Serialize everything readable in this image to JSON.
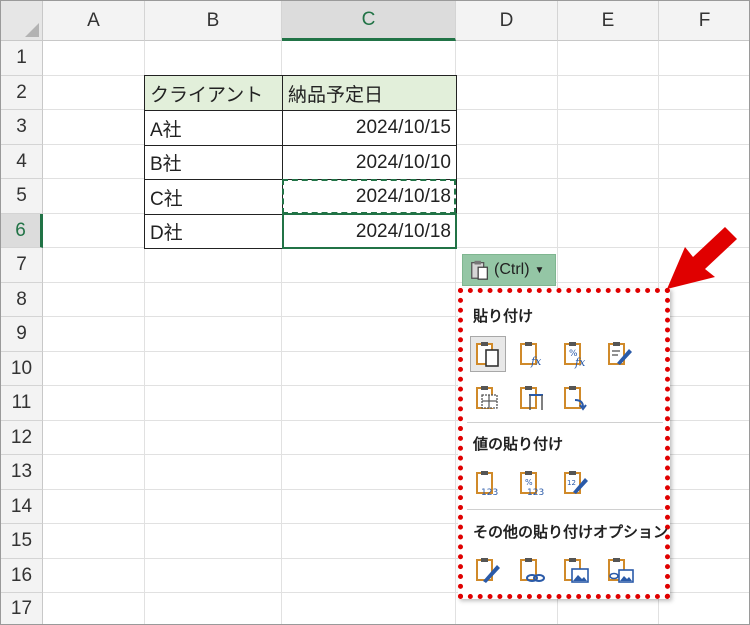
{
  "columns": [
    "A",
    "B",
    "C",
    "D",
    "E",
    "F"
  ],
  "rows": [
    "1",
    "2",
    "3",
    "4",
    "5",
    "6",
    "7",
    "8",
    "9",
    "10",
    "11",
    "12",
    "13",
    "14",
    "15",
    "16",
    "17"
  ],
  "table": {
    "headers": [
      "クライアント",
      "納品予定日"
    ],
    "rows": [
      [
        "A社",
        "2024/10/15"
      ],
      [
        "B社",
        "2024/10/10"
      ],
      [
        "C社",
        "2024/10/18"
      ],
      [
        "D社",
        "2024/10/18"
      ]
    ]
  },
  "paste_options_button": {
    "label": "(Ctrl)",
    "icon": "clipboard-icon"
  },
  "paste_menu": {
    "section_paste": "貼り付け",
    "section_values": "値の貼り付け",
    "section_other": "その他の貼り付けオプション",
    "paste_icons": [
      "paste-icon",
      "paste-formulas-icon",
      "paste-formulas-number-format-icon",
      "paste-keep-source-formatting-icon",
      "paste-no-borders-icon",
      "paste-keep-column-widths-icon",
      "paste-transpose-icon"
    ],
    "values_icons": [
      "paste-values-icon",
      "paste-values-number-format-icon",
      "paste-values-source-formatting-icon"
    ],
    "other_icons": [
      "paste-formatting-icon",
      "paste-link-icon",
      "paste-picture-icon",
      "paste-linked-picture-icon"
    ]
  },
  "colors": {
    "accent": "#217346",
    "header_fill": "#e2efda",
    "highlight": "#e00000"
  }
}
